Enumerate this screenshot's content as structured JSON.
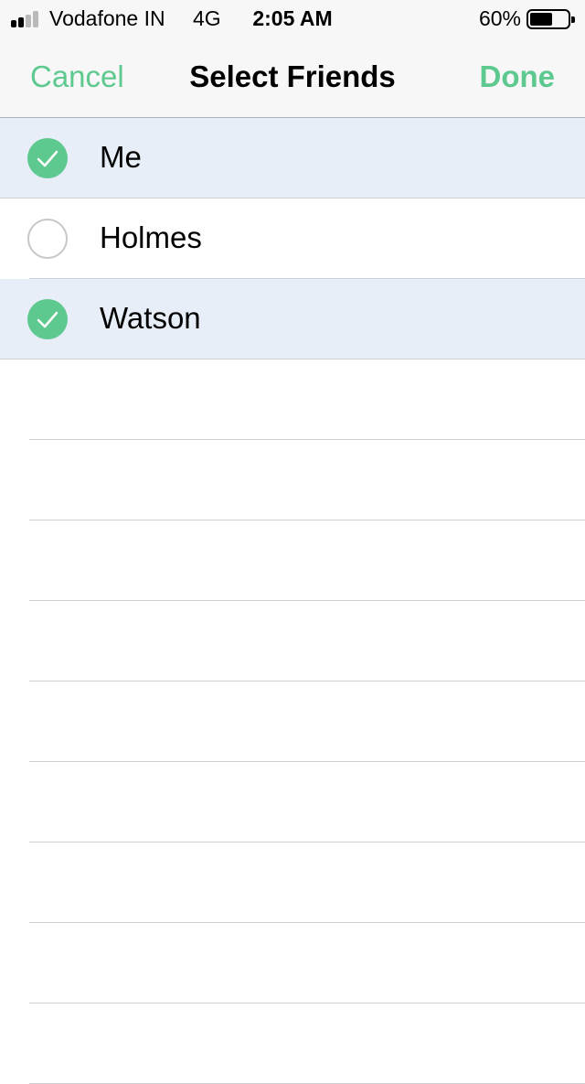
{
  "status_bar": {
    "carrier": "Vodafone IN",
    "network": "4G",
    "time": "2:05 AM",
    "battery_percent": "60%",
    "battery_level": 0.6,
    "signal_bars_active": 2,
    "signal_bars_total": 4
  },
  "nav": {
    "cancel_label": "Cancel",
    "title": "Select Friends",
    "done_label": "Done"
  },
  "colors": {
    "accent": "#5ec98f",
    "selected_row_bg": "#e8eef8",
    "signal_inactive": "#b9b9b9"
  },
  "friends": [
    {
      "name": "Me",
      "selected": true
    },
    {
      "name": "Holmes",
      "selected": false
    },
    {
      "name": "Watson",
      "selected": true
    }
  ],
  "icons": {
    "selected": "checkmark-circle-icon",
    "unselected": "empty-circle-icon",
    "signal": "signal-strength-icon",
    "battery": "battery-icon"
  }
}
